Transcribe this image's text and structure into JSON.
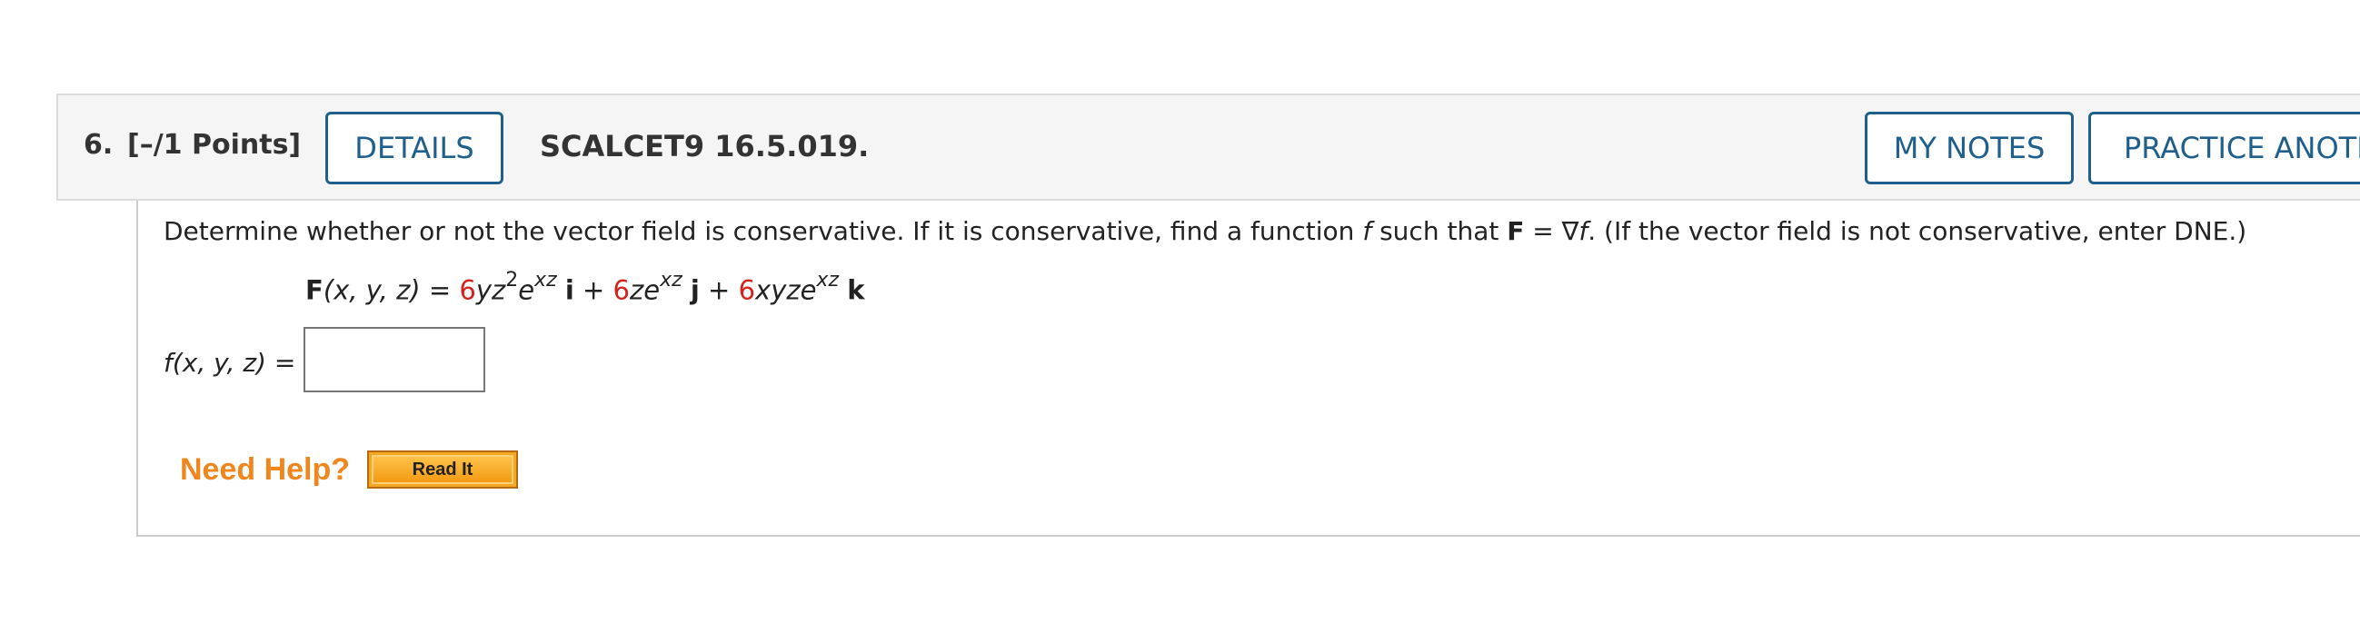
{
  "question": {
    "number": "6.",
    "points": "[–/1 Points]",
    "details_label": "DETAILS",
    "code": "SCALCET9 16.5.019.",
    "my_notes_label": "MY NOTES",
    "practice_label": "PRACTICE ANOTHER"
  },
  "prompt": {
    "part1": "Determine whether or not the vector field is conservative. If it is conservative, find a function ",
    "f_symbol": "f",
    "part2": " such that ",
    "F_symbol": "F",
    "part3": " = ∇",
    "f_symbol2": "f",
    "part4": ". (If the vector field is not conservative, enter DNE.)"
  },
  "equation": {
    "lhs_F": "F",
    "lhs_args": "(x, y, z)",
    "equals": " = ",
    "coef1": "6",
    "term1": "yz",
    "term1_sup": "2",
    "term1_e": "e",
    "term1_exp": "xz",
    "unit_i": "i",
    "plus1": " + ",
    "coef2": "6",
    "term2": "ze",
    "term2_exp": "xz",
    "unit_j": "j",
    "plus2": " + ",
    "coef3": "6",
    "term3": "xyze",
    "term3_exp": "xz",
    "unit_k": "k"
  },
  "answer": {
    "label": "f(x, y, z) =",
    "value": ""
  },
  "help": {
    "label": "Need Help?",
    "read_it_label": "Read It"
  },
  "colors": {
    "accent": "#1f5f8b",
    "coefficient_red": "#d4231c",
    "help_orange": "#f0861e"
  }
}
